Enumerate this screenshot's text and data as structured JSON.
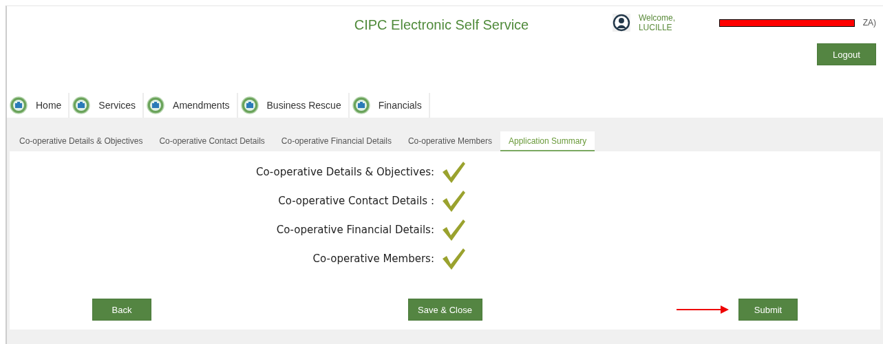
{
  "header": {
    "title": "CIPC Electronic Self Service",
    "welcome": "Welcome, LUCILLE",
    "welcome_tail": "ZA)",
    "redacted": true,
    "logout": "Logout"
  },
  "nav": [
    {
      "label": "Home"
    },
    {
      "label": "Services"
    },
    {
      "label": "Amendments"
    },
    {
      "label": "Business Rescue"
    },
    {
      "label": "Financials"
    }
  ],
  "tabs": [
    {
      "label": "Co-operative Details & Objectives",
      "selected": false
    },
    {
      "label": "Co-operative Contact Details",
      "selected": false
    },
    {
      "label": "Co-operative Financial Details",
      "selected": false
    },
    {
      "label": "Co-operative Members",
      "selected": false
    },
    {
      "label": "Application Summary",
      "selected": true
    }
  ],
  "summary": [
    {
      "label": "Co-operative Details & Objectives:",
      "done": true
    },
    {
      "label": "Co-operative Contact Details :",
      "done": true
    },
    {
      "label": "Co-operative Financial Details:",
      "done": true
    },
    {
      "label": "Co-operative Members:",
      "done": true
    }
  ],
  "buttons": {
    "back": "Back",
    "save": "Save & Close",
    "submit": "Submit"
  }
}
